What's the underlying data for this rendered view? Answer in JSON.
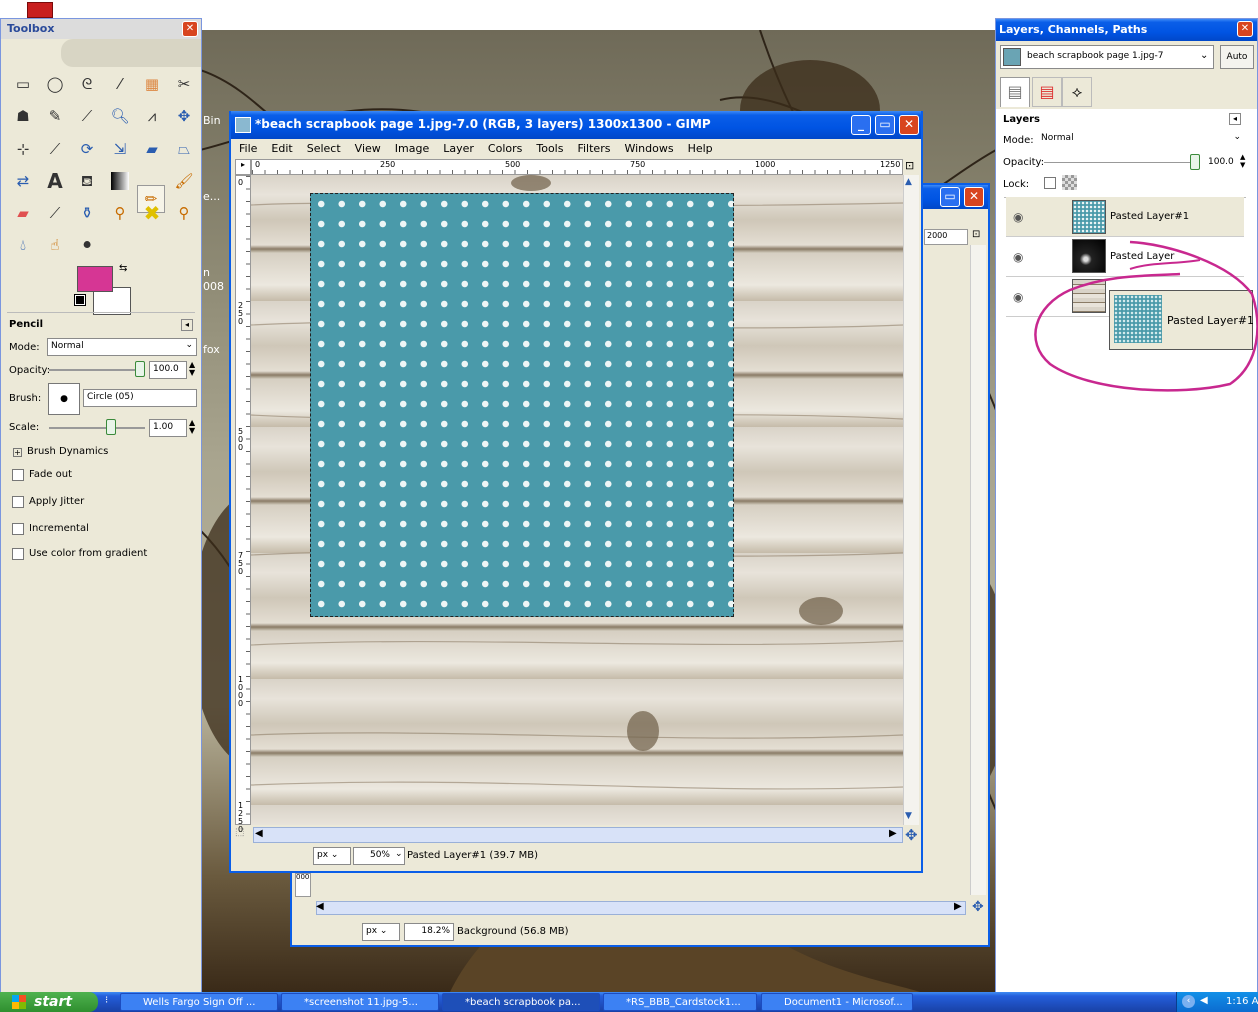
{
  "desktop": {
    "bin_label": "Bin",
    "text_e": "e...",
    "text_n": "n",
    "text_year": "008",
    "text_fox": "fox"
  },
  "toolbox": {
    "title": "Toolbox",
    "tool_options_title": "Pencil",
    "mode_label": "Mode:",
    "mode_value": "Normal",
    "opacity_label": "Opacity:",
    "opacity_value": "100.0",
    "brush_label": "Brush:",
    "brush_value": "Circle (05)",
    "scale_label": "Scale:",
    "scale_value": "1.00",
    "brush_dynamics": "Brush Dynamics",
    "fade_out": "Fade out",
    "apply_jitter": "Apply Jitter",
    "incremental": "Incremental",
    "use_gradient": "Use color from gradient",
    "fg_color": "#d63694",
    "bg_color": "#ffffff"
  },
  "gimp": {
    "title": "*beach scrapbook page 1.jpg-7.0 (RGB, 3 layers) 1300x1300 - GIMP",
    "menu": [
      "File",
      "Edit",
      "Select",
      "View",
      "Image",
      "Layer",
      "Colors",
      "Tools",
      "Filters",
      "Windows",
      "Help"
    ],
    "ruler_top": [
      "0",
      "250",
      "500",
      "750",
      "1000",
      "1250"
    ],
    "ruler_left": [
      "0",
      "250",
      "500",
      "750",
      "1000",
      "1250"
    ],
    "unit": "px",
    "zoom": "50%",
    "status": "Pasted Layer#1 (39.7 MB)",
    "paper_color": "#4a9aaa"
  },
  "gimp2": {
    "ruler_mark": "2000",
    "ruler_left": "000",
    "unit": "px",
    "zoom": "18.2%",
    "status": "Background (56.8 MB)"
  },
  "layers": {
    "title": "Layers, Channels, Paths",
    "image_select": "beach scrapbook page 1.jpg-7",
    "auto_label": "Auto",
    "panel_title": "Layers",
    "mode_label": "Mode:",
    "mode_value": "Normal",
    "opacity_label": "Opacity:",
    "opacity_value": "100.0",
    "lock_label": "Lock:",
    "rows": [
      {
        "name": "Pasted Layer#1"
      },
      {
        "name": "Pasted Layer"
      }
    ],
    "drag_label": "Pasted Layer#1"
  },
  "taskbar": {
    "start": "start",
    "tasks": [
      "Wells Fargo Sign Off ...",
      "*screenshot 11.jpg-5...",
      "*beach scrapbook pa...",
      "*RS_BBB_Cardstock1...",
      "Document1 - Microsof..."
    ],
    "clock": "1:16 A"
  }
}
